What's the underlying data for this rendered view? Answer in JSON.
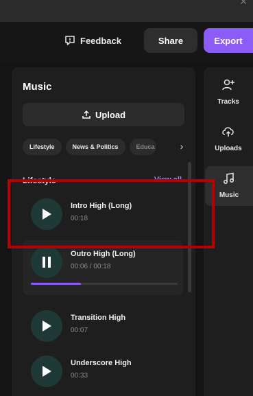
{
  "topbar": {
    "feedback_label": "Feedback",
    "share_label": "Share",
    "export_label": "Export",
    "accent_color": "#8b5cf6"
  },
  "panel": {
    "title": "Music",
    "upload_label": "Upload",
    "categories": [
      "Lifestyle",
      "News & Politics",
      "Educa"
    ],
    "section_title": "Lifestyle",
    "view_all_label": "View all"
  },
  "tracks": [
    {
      "name": "Intro High (Long)",
      "duration": "00:18",
      "state": "play-icon"
    },
    {
      "name": "Outro High (Long)",
      "duration": "00:06 / 00:18",
      "state": "pause-icon",
      "progress": 0.34
    },
    {
      "name": "Transition High",
      "duration": "00:07",
      "state": "play-icon"
    },
    {
      "name": "Underscore High",
      "duration": "00:33",
      "state": "play-icon"
    }
  ],
  "rail": {
    "items": [
      {
        "label": "Tracks",
        "icon": "tracks-icon"
      },
      {
        "label": "Uploads",
        "icon": "uploads-icon"
      },
      {
        "label": "Music",
        "icon": "music-icon"
      }
    ]
  }
}
